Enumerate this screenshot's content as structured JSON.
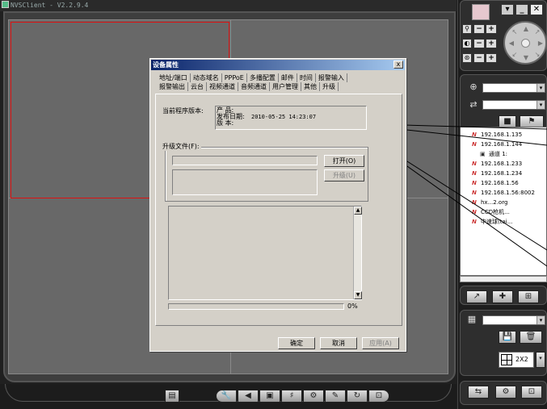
{
  "app": {
    "title": "NVSClient - V2.2.9.4"
  },
  "dialog": {
    "title": "设备属性",
    "close_label": "x",
    "tabs_row1": [
      "地址/端口",
      "动态域名",
      "PPPoE",
      "多播配置",
      "邮件",
      "时间",
      "报警输入"
    ],
    "tabs_row2": [
      "报警输出",
      "云台",
      "视频通道",
      "音频通道",
      "用户管理",
      "其他",
      "升级"
    ],
    "active_tab": "升级",
    "version_label": "当前程序版本:",
    "version_lines": [
      "产    品:",
      "发布日期:",
      "版    本:"
    ],
    "release_date": "2010-05-25 14:23:07",
    "upgrade_file_label": "升级文件(F):",
    "open_button": "打开(O)",
    "upgrade_button": "升级(U)",
    "progress_text": "0%",
    "progress_value": 0,
    "ok_button": "确定",
    "cancel_button": "取消",
    "apply_button": "应用(A)"
  },
  "tree": {
    "nodes": [
      {
        "label": "192.168.1.135",
        "indent": 1,
        "type": "device"
      },
      {
        "label": "192.168.1.144",
        "indent": 1,
        "type": "device"
      },
      {
        "label": "通道 1:",
        "indent": 2,
        "type": "channel"
      },
      {
        "label": "192.168.1.233",
        "indent": 1,
        "type": "device"
      },
      {
        "label": "192.168.1.234",
        "indent": 1,
        "type": "device"
      },
      {
        "label": "192.168.1.56",
        "indent": 1,
        "type": "device"
      },
      {
        "label": "192.168.1.56:8002",
        "indent": 1,
        "type": "device"
      },
      {
        "label": "hx...2.org",
        "indent": 1,
        "type": "device"
      },
      {
        "label": "CCD枪机...",
        "indent": 1,
        "type": "device"
      },
      {
        "label": "中速球(tai...",
        "indent": 1,
        "type": "device"
      }
    ]
  },
  "right_panel": {
    "layout_label": "2X2",
    "swatch_color": "#e6c8cf"
  },
  "colors": {
    "active_pane_border": "#dd1111",
    "titlebar_start": "#0a246a",
    "titlebar_end": "#a6caf0"
  }
}
